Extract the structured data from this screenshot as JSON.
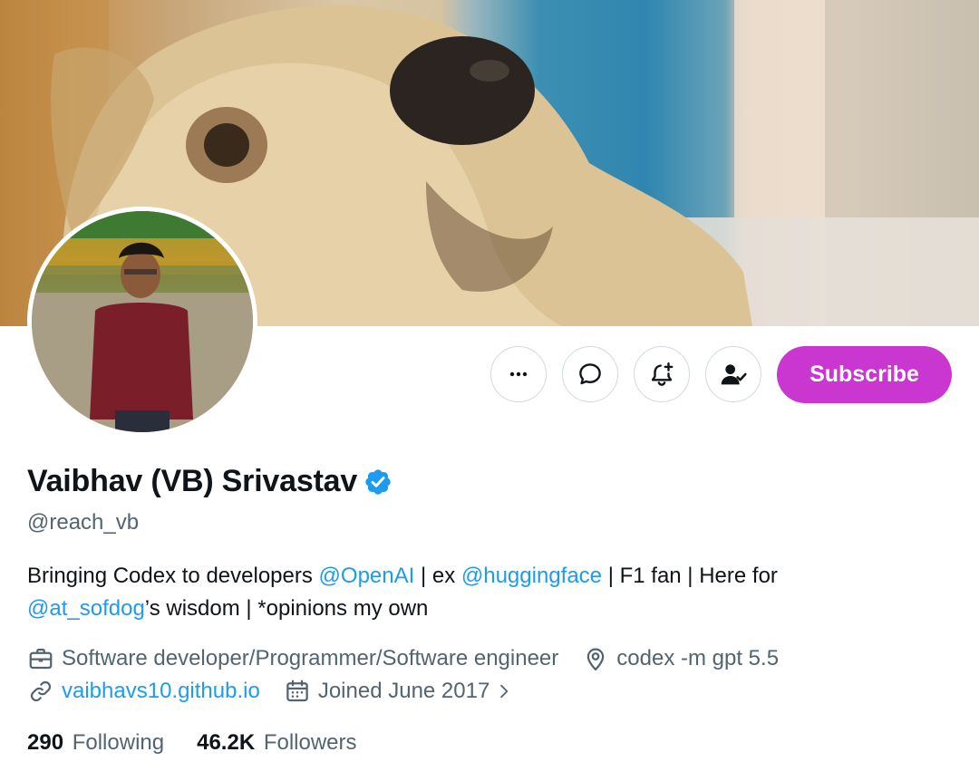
{
  "profile": {
    "display_name": "Vaibhav (VB) Srivastav",
    "handle": "@reach_vb",
    "bio": {
      "line1_part1": "Bringing Codex to developers ",
      "mention_openai": "@OpenAI",
      "line1_part2": " | ex ",
      "mention_huggingface": "@huggingface",
      "line1_part3": " | F1 fan | Here for",
      "mention_sofdog": "@at_sofdog",
      "line2_part": "’s wisdom | *opinions my own"
    },
    "profession": "Software developer/Programmer/Software engineer",
    "location": "codex -m gpt 5.5",
    "website": "vaibhavs10.github.io",
    "joined": "Joined June 2017",
    "following_count": "290",
    "following_label": "Following",
    "followers_count": "46.2K",
    "followers_label": "Followers"
  },
  "actions": {
    "subscribe_label": "Subscribe"
  },
  "icons": {
    "more": "more-icon",
    "message": "message-icon",
    "notify": "bell-plus-icon",
    "following": "person-check-icon",
    "verified": "verified-badge-icon",
    "briefcase": "briefcase-icon",
    "location": "location-pin-icon",
    "link": "link-icon",
    "calendar": "calendar-icon",
    "chevron": "chevron-right-icon"
  },
  "colors": {
    "accent": "#1d9bf0",
    "subscribe": "#c936d0",
    "text_primary": "#0f1419",
    "text_secondary": "#536471"
  }
}
